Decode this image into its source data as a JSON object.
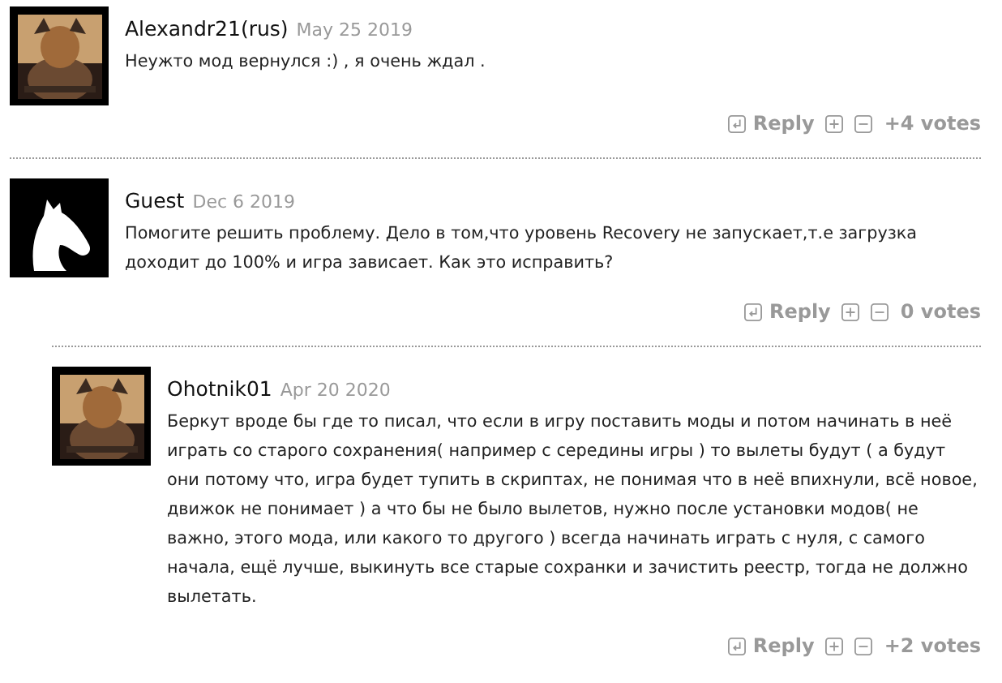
{
  "comments": [
    {
      "author": "Alexandr21(rus)",
      "date": "May 25 2019",
      "text": "Неужто мод вернулся :) , я очень ждал .",
      "actions": {
        "reply": "Reply",
        "votes": "+4 votes"
      }
    },
    {
      "author": "Guest",
      "date": "Dec 6 2019",
      "avatar": {
        "kind": "default"
      },
      "text": "Помогите решить проблему. Дело в том,что уровень Recovery не запускает,т.е загрузка доходит до 100% и игра зависает. Как это исправить?",
      "actions": {
        "reply": "Reply",
        "votes": "0 votes"
      },
      "children": [
        {
          "author": "Ohotnik01",
          "date": "Apr 20 2020",
          "text": "Беркут вроде бы где то писал, что если в игру поставить моды и потом начинать в неё играть со старого сохранения( например с середины игры ) то вылеты будут ( а будут они потому что, игра будет тупить в скриптах, не понимая что в неё впихнули, всё новое, движок не понимает ) а что бы не было вылетов, нужно после установки модов( не важно, этого мода, или какого то другого ) всегда начинать играть с нуля, с самого начала, ещё лучше, выкинуть все старые сохранки и зачистить реестр, тогда не должно вылетать.",
          "actions": {
            "reply": "Reply",
            "votes": "+2 votes"
          }
        }
      ]
    }
  ]
}
